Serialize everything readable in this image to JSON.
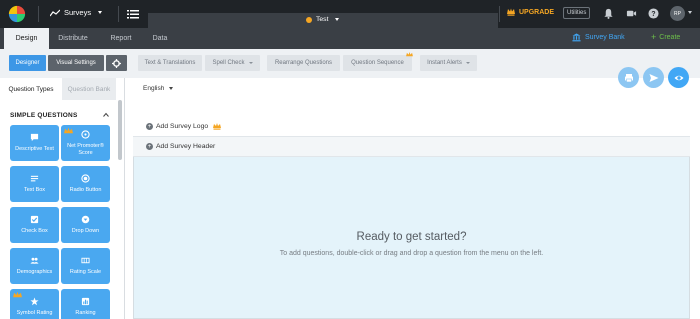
{
  "topbar": {
    "app_label": "Surveys",
    "survey_title": "Test",
    "upgrade_label": "UPGRADE",
    "utilities_label": "Utilities",
    "avatar_initials": "RP",
    "icons": [
      "app-logo-icon",
      "chart-line-icon",
      "menu-list-icon",
      "crown-icon",
      "bell-icon",
      "video-icon",
      "help-icon"
    ]
  },
  "tabs": [
    "Design",
    "Distribute",
    "Report",
    "Data"
  ],
  "tab_actions": {
    "survey_bank_label": "Survey Bank",
    "create_label": "Create"
  },
  "toolbar": {
    "designer_label": "Designer",
    "visual_settings_label": "Visual Settings",
    "text_translations_label": "Text & Translations",
    "spell_check_label": "Spell Check",
    "rearrange_label": "Rearrange Questions",
    "question_sequence_label": "Question Sequence",
    "instant_alerts_label": "Instant Alerts"
  },
  "left_panel": {
    "tab_question_types": "Question Types",
    "tab_question_bank": "Question Bank",
    "section_title": "SIMPLE QUESTIONS",
    "question_types": [
      {
        "label": "Descriptive Text",
        "icon": "comment-icon"
      },
      {
        "label": "Net Promoter® Score",
        "icon": "nps-icon"
      },
      {
        "label": "Text Box",
        "icon": "lines-icon"
      },
      {
        "label": "Radio Button",
        "icon": "radio-icon"
      },
      {
        "label": "Check Box",
        "icon": "checkbox-icon"
      },
      {
        "label": "Drop Down",
        "icon": "dropdown-icon"
      },
      {
        "label": "Demographics",
        "icon": "people-icon"
      },
      {
        "label": "Rating Scale",
        "icon": "scale-icon"
      },
      {
        "label": "Symbol Rating",
        "icon": "star-icon"
      },
      {
        "label": "Ranking",
        "icon": "ranking-icon"
      }
    ]
  },
  "editor": {
    "language": "English",
    "add_logo_label": "Add Survey Logo",
    "add_header_label": "Add Survey Header",
    "ready_title": "Ready to get started?",
    "ready_subtitle": "To add questions, double-click or drag and drop a question from the menu on the left."
  },
  "colors": {
    "topbar_bg": "#1f2327",
    "tabbar_bg": "#3a3f45",
    "accent_blue": "#4aa8f0",
    "upgrade_orange": "#f5a623",
    "create_green": "#6dbf4a",
    "canvas_bg": "#e4f3fa"
  }
}
